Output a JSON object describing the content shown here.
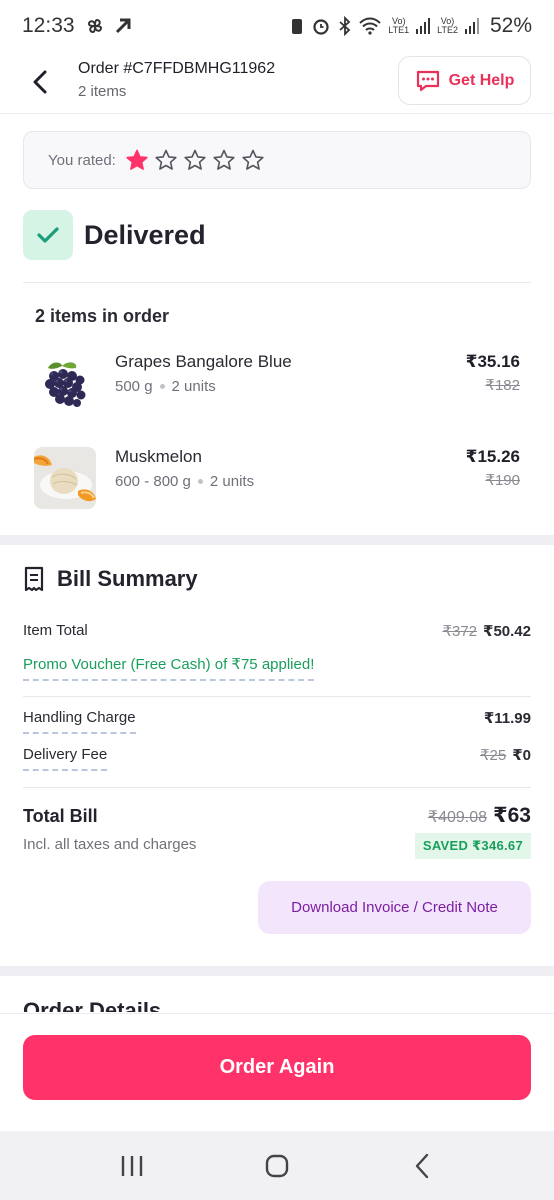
{
  "status_bar": {
    "time": "12:33",
    "battery": "52%",
    "sim1": "LTE1",
    "sim2": "LTE2"
  },
  "header": {
    "order_id": "Order #C7FFDBMHG11962",
    "items_count": "2 items",
    "help_label": "Get Help"
  },
  "rating": {
    "label": "You rated:",
    "value": 1,
    "max": 5
  },
  "status": {
    "label": "Delivered"
  },
  "items_section": {
    "heading": "2 items in order",
    "items": [
      {
        "name": "Grapes Bangalore Blue",
        "qty": "500 g",
        "units": "2 units",
        "price": "₹35.16",
        "mrp": "₹182"
      },
      {
        "name": "Muskmelon",
        "qty": "600 - 800 g",
        "units": "2 units",
        "price": "₹15.26",
        "mrp": "₹190"
      }
    ]
  },
  "bill": {
    "title": "Bill Summary",
    "item_total_label": "Item Total",
    "item_total_mrp": "₹372",
    "item_total": "₹50.42",
    "promo": "Promo Voucher (Free Cash) of ₹75 applied!",
    "handling_label": "Handling Charge",
    "handling_value": "₹11.99",
    "delivery_label": "Delivery Fee",
    "delivery_mrp": "₹25",
    "delivery_value": "₹0",
    "total_label": "Total Bill",
    "total_sub": "Incl. all taxes and charges",
    "total_mrp": "₹409.08",
    "total_value": "₹63",
    "saved": "SAVED ₹346.67",
    "invoice_button": "Download Invoice / Credit Note"
  },
  "order_details_title": "Order Details",
  "order_again_button": "Order Again",
  "colors": {
    "accent": "#ff3269",
    "help": "#e8325a",
    "success": "#1a9e5c",
    "invoice": "#7b1fa2"
  }
}
